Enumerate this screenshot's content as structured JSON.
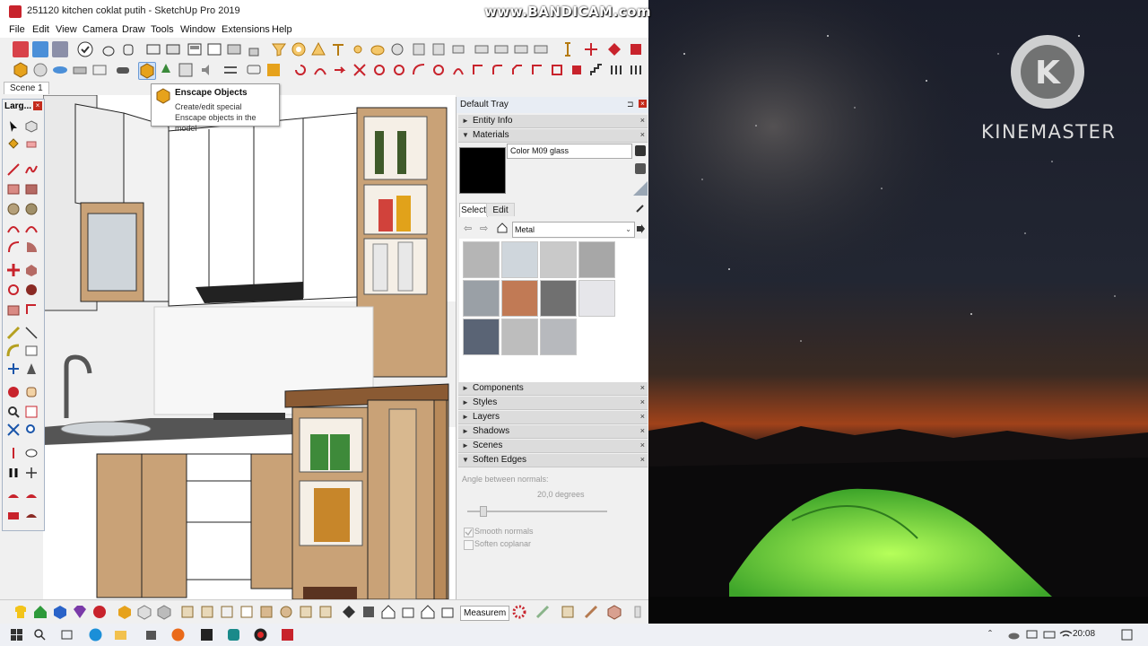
{
  "window": {
    "title": "251120 kitchen coklat putih - SketchUp Pro 2019"
  },
  "watermark": "www.BANDICAM.com",
  "menu": [
    "File",
    "Edit",
    "View",
    "Camera",
    "Draw",
    "Tools",
    "Window",
    "Extensions",
    "Help"
  ],
  "scene_tab": "Scene 1",
  "palette": {
    "title": "Larg...",
    "close": "×"
  },
  "tooltip": {
    "title": "Enscape Objects",
    "description": "Create/edit special Enscape objects in the model"
  },
  "tray": {
    "title": "Default Tray",
    "panels_top": [
      {
        "label": "Entity Info",
        "arrow": "►"
      },
      {
        "label": "Materials",
        "arrow": "▼"
      }
    ],
    "materials": {
      "name": "Color M09 glass",
      "tab_select": "Select",
      "tab_edit": "Edit",
      "library": "Metal",
      "swatch_colors": [
        "#b5b5b5",
        "#cfd6dc",
        "#c9c9c9",
        "#a7a7a7",
        "#9aa0a6",
        "#c17a55",
        "#707070",
        "#e6e6ea",
        "#5a6475",
        "#bdbdbd",
        "#b7b9bd"
      ]
    },
    "panels_bottom": [
      {
        "label": "Components",
        "arrow": "►"
      },
      {
        "label": "Styles",
        "arrow": "►"
      },
      {
        "label": "Layers",
        "arrow": "►"
      },
      {
        "label": "Shadows",
        "arrow": "►"
      },
      {
        "label": "Scenes",
        "arrow": "►"
      },
      {
        "label": "Soften Edges",
        "arrow": "▼"
      }
    ],
    "soften_edges": {
      "angle_label": "Angle between normals:",
      "angle_value": "20,0  degrees",
      "smooth_label": "Smooth normals",
      "coplanar_label": "Soften coplanar"
    },
    "close_glyph": "×"
  },
  "statusbar": {
    "measurements_label": "Measurem"
  },
  "overlay": {
    "kinemaster": "KINEMASTER"
  },
  "taskbar": {
    "time": "20:08"
  },
  "colors": {
    "accent_red": "#c8232c",
    "enscape_yellow": "#e6a21c",
    "tent_green": "#5fd63a"
  }
}
